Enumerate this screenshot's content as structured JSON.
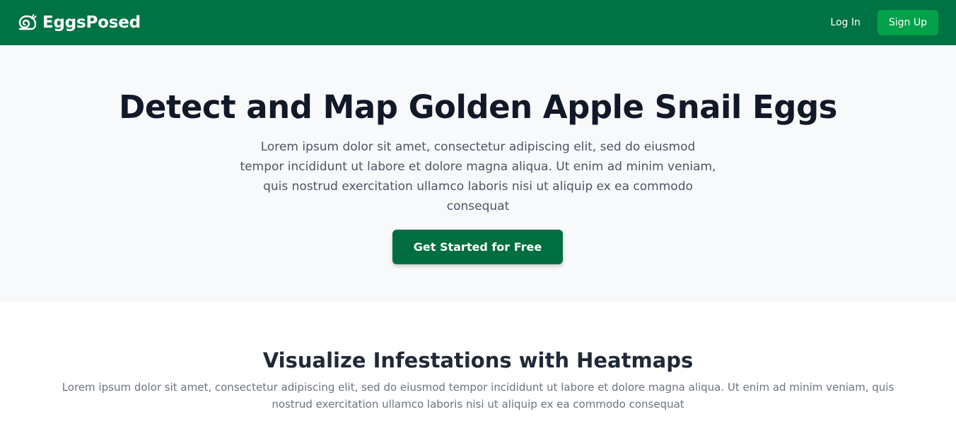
{
  "navbar": {
    "brand_name": "EggsPosed",
    "brand_icon": "snail-logo-icon",
    "login_label": "Log In",
    "signup_label": "Sign Up"
  },
  "hero": {
    "title": "Detect and Map Golden Apple Snail Eggs",
    "description": "Lorem ipsum dolor sit amet, consectetur adipiscing elit, sed do eiusmod tempor incididunt ut labore et dolore magna aliqua. Ut enim ad minim veniam, quis nostrud exercitation ullamco laboris nisi ut aliquip ex ea commodo consequat",
    "cta_label": "Get Started for Free"
  },
  "features": {
    "title": "Visualize Infestations with Heatmaps",
    "description": "Lorem ipsum dolor sit amet, consectetur adipiscing elit, sed do eiusmod tempor incididunt ut labore et dolore magna aliqua. Ut enim ad minim veniam, quis nostrud exercitation ullamco laboris nisi ut aliquip ex ea commodo consequat"
  },
  "colors": {
    "navbar_bg": "#007344",
    "signup_bg": "#03a24a",
    "cta_bg": "#016e41",
    "hero_bg": "#f8f9fb",
    "heading_text": "#111827",
    "body_text": "#4b5563"
  }
}
